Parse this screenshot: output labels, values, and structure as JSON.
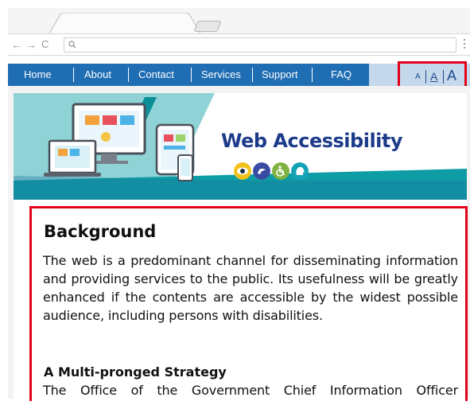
{
  "browser": {
    "back_icon": "back-arrow-icon",
    "forward_icon": "forward-arrow-icon",
    "reload_icon": "reload-icon",
    "back_glyph": "←",
    "forward_glyph": "→",
    "reload_glyph": "C",
    "address_value": ""
  },
  "nav": {
    "items": [
      "Home",
      "About",
      "Contact",
      "Services",
      "Support",
      "FAQ"
    ],
    "font_size": {
      "small": "A",
      "medium": "A",
      "large": "A"
    },
    "colors": {
      "bar": "#1f6db3",
      "highlight": "#e3001b"
    }
  },
  "banner": {
    "title": "Web Accessibility",
    "icons": [
      "eye-icon",
      "sign-language-icon",
      "wheelchair-icon",
      "head-icon"
    ]
  },
  "content": {
    "heading": "Background",
    "paragraph": "The web is a predominant channel for disseminating information and providing services to the public. Its usefulness will be greatly enhanced if the contents are accessible by the widest possible audience, including persons with disabilities.",
    "subheading": "A Multi-pronged Strategy",
    "paragraph2": "The Office of the Government Chief Information Officer"
  }
}
